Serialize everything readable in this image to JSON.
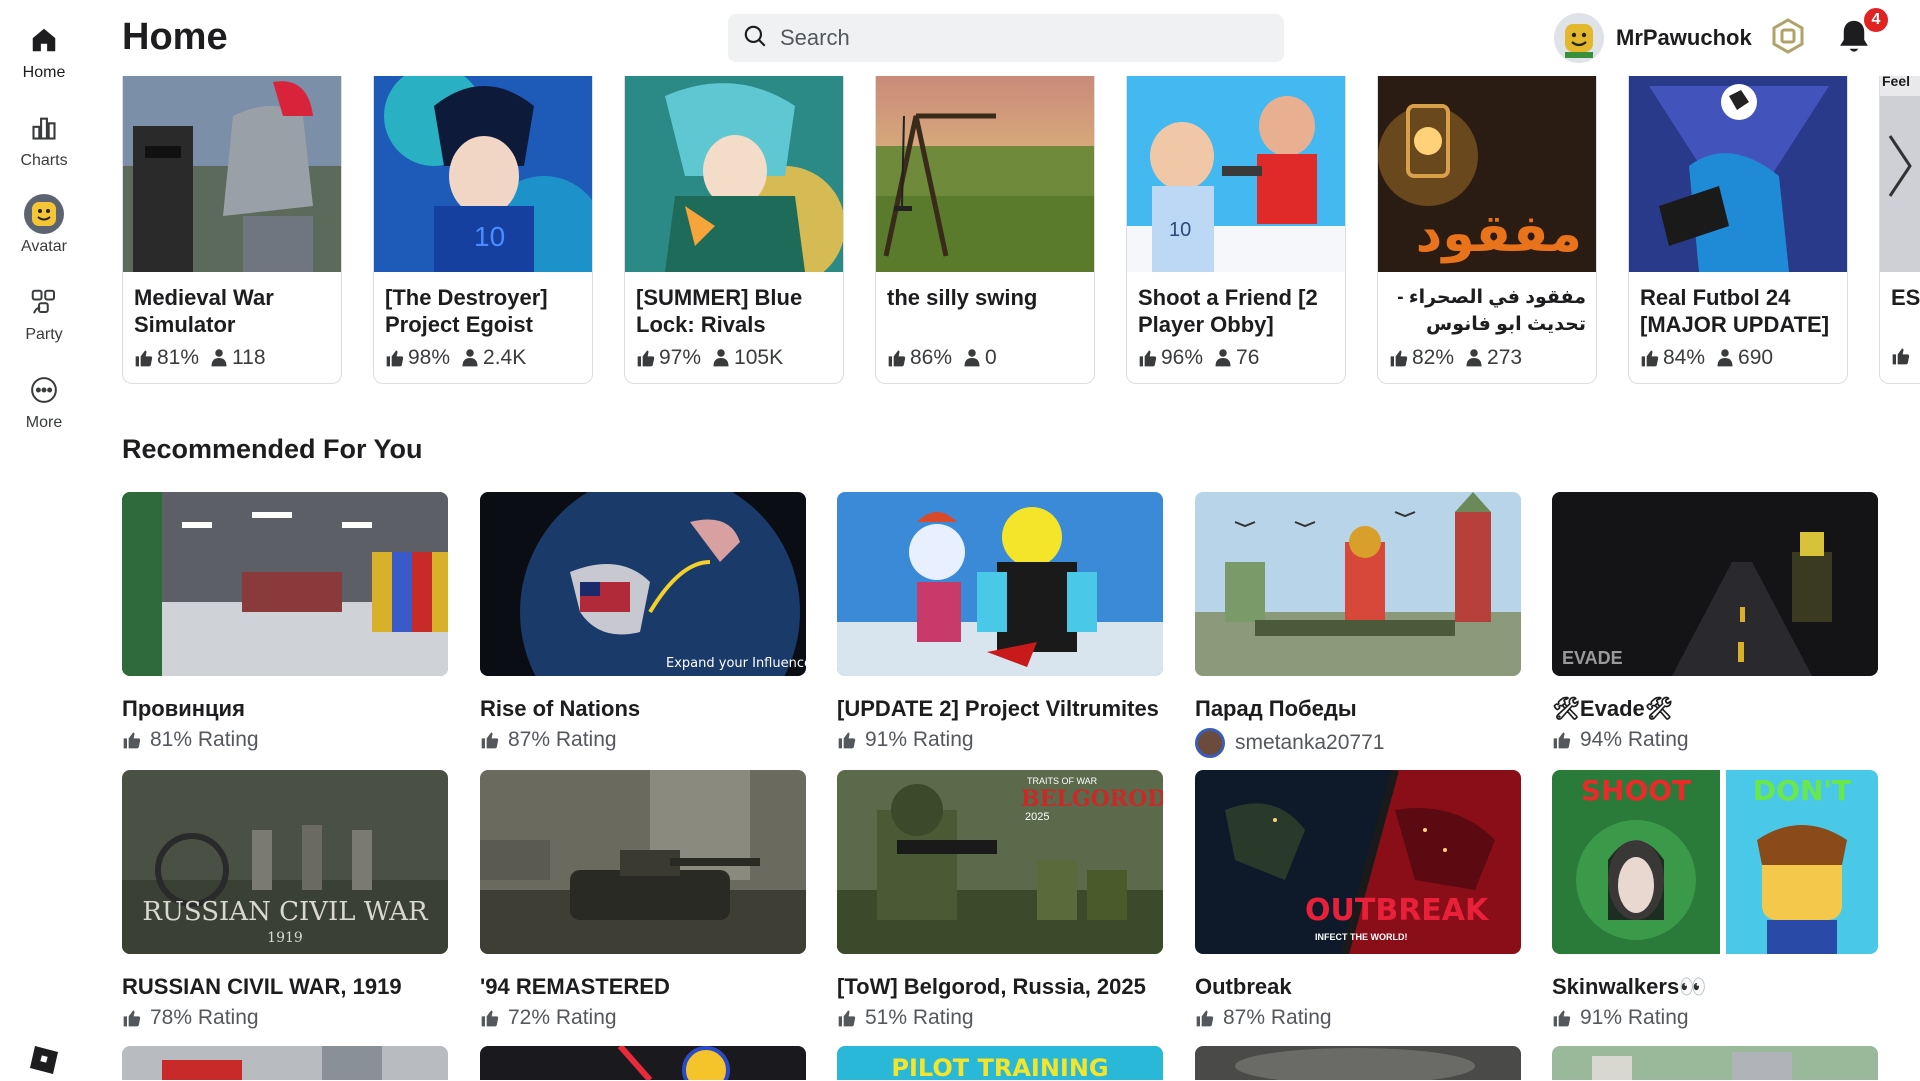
{
  "header": {
    "title": "Home",
    "search_placeholder": "Search",
    "username": "MrPawuchok",
    "notification_count": "4"
  },
  "sidebar": {
    "items": [
      {
        "label": "Home",
        "icon": "home-icon"
      },
      {
        "label": "Charts",
        "icon": "charts-icon"
      },
      {
        "label": "Avatar",
        "icon": "avatar-icon"
      },
      {
        "label": "Party",
        "icon": "party-icon"
      },
      {
        "label": "More",
        "icon": "more-icon"
      }
    ]
  },
  "top_games": [
    {
      "title": "Medieval War Simulator",
      "rating": "81%",
      "players": "118"
    },
    {
      "title": "[The Destroyer] Project Egoist",
      "rating": "98%",
      "players": "2.4K"
    },
    {
      "title": "[SUMMER] Blue Lock: Rivals",
      "rating": "97%",
      "players": "105K"
    },
    {
      "title": "the silly swing",
      "rating": "86%",
      "players": "0"
    },
    {
      "title": "Shoot a Friend [2 Player Obby]",
      "rating": "96%",
      "players": "76"
    },
    {
      "title": "مفقود في الصحراء - تحديث ابو فانوس",
      "rating": "82%",
      "players": "273"
    },
    {
      "title": "Real Futbol 24 [MAJOR UPDATE]",
      "rating": "84%",
      "players": "690"
    },
    {
      "title": "ES SH",
      "rating": "",
      "players": ""
    }
  ],
  "recommended": {
    "title": "Recommended For You",
    "games": [
      {
        "title": "Провинция",
        "sub": "81% Rating"
      },
      {
        "title": "Rise of Nations",
        "sub": "87% Rating"
      },
      {
        "title": "[UPDATE 2] Project Viltrumites",
        "sub": "91% Rating"
      },
      {
        "title": "Парад Победы",
        "sub": "smetanka20771"
      },
      {
        "title": "🛠Evade🛠",
        "sub": "94% Rating"
      },
      {
        "title": "RUSSIAN CIVIL WAR, 1919",
        "sub": "78% Rating"
      },
      {
        "title": "'94 REMASTERED",
        "sub": "72% Rating"
      },
      {
        "title": "[ToW] Belgorod, Russia, 2025",
        "sub": "51% Rating"
      },
      {
        "title": "Outbreak",
        "sub": "87% Rating"
      },
      {
        "title": "Skinwalkers👀",
        "sub": "91% Rating"
      }
    ]
  },
  "thumb_texts": {
    "arabic_logo": "مفقود",
    "rise_caption": "Expand your Influence",
    "evade_logo": "EVADE",
    "rcw_logo": "RUSSIAN CIVIL WAR",
    "rcw_year": "1919",
    "belgorod_pre": "TRAITS OF WAR",
    "belgorod_logo": "BELGOROD",
    "belgorod_year": "2025",
    "outbreak_logo": "OUTBREAK",
    "outbreak_tag": "INFECT THE WORLD!",
    "skin_left": "SHOOT",
    "skin_right": "DON'T",
    "pilot": "PILOT TRAINING",
    "peek_card": "Feel"
  }
}
